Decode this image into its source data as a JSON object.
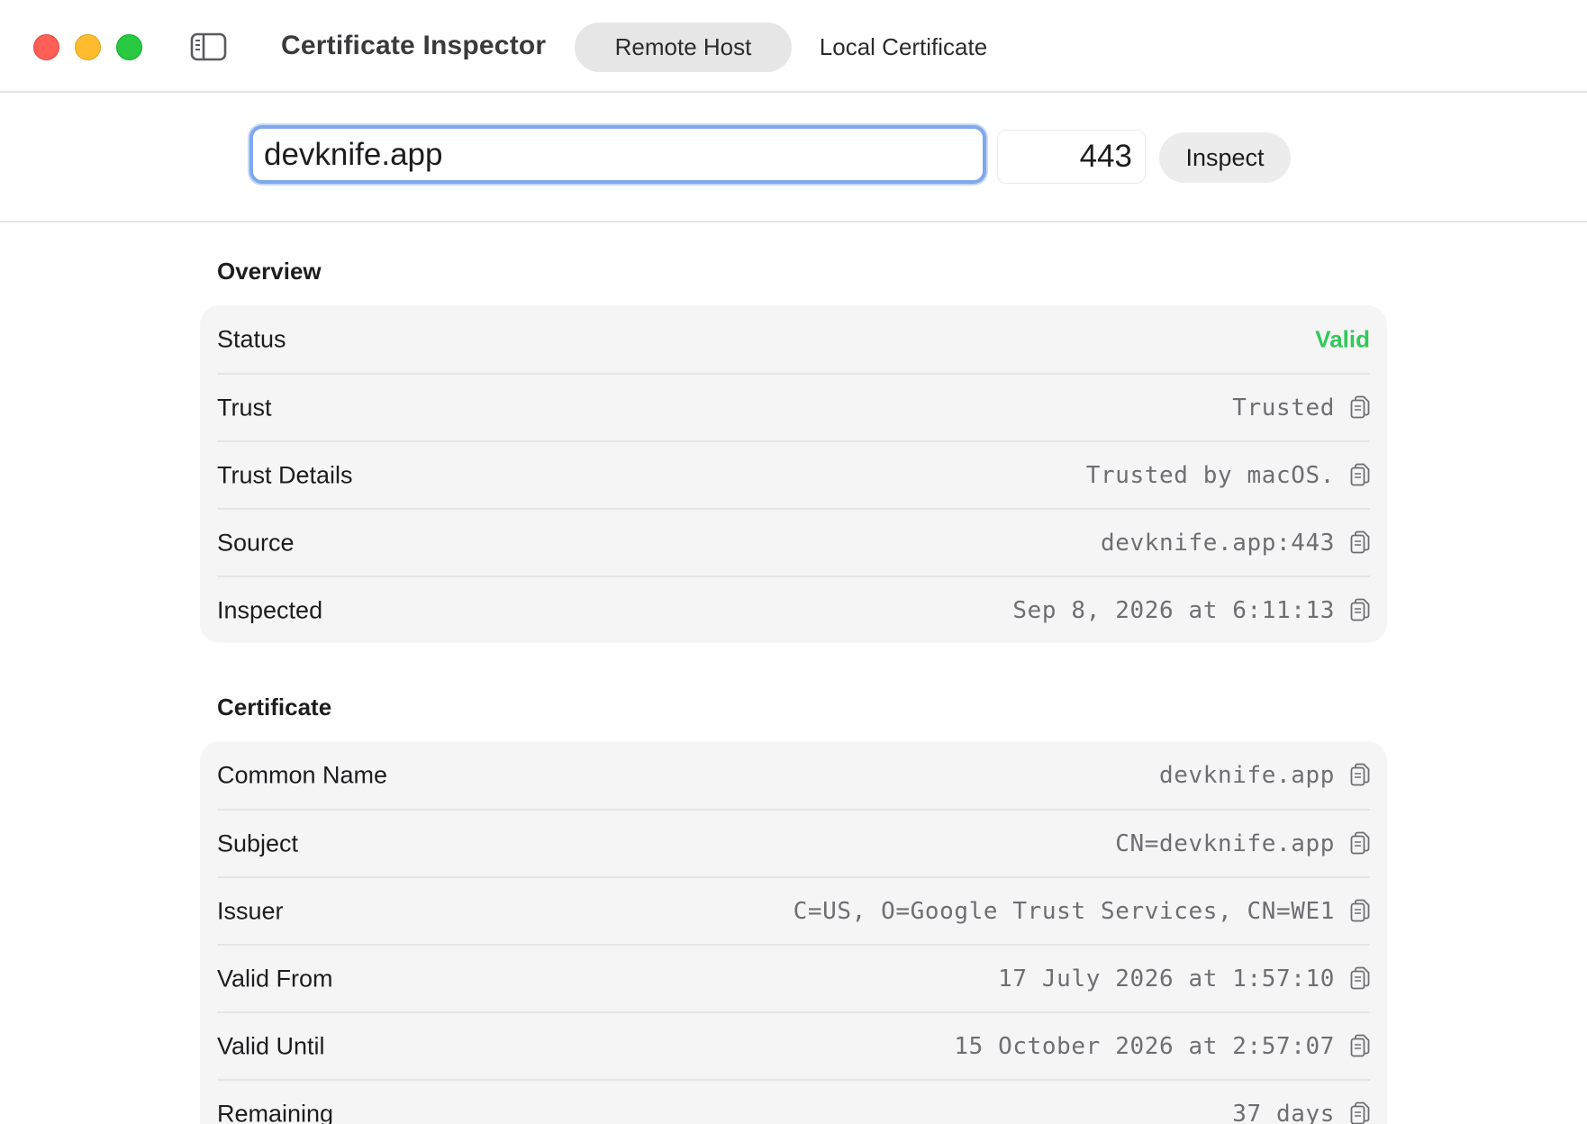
{
  "window": {
    "title": "Certificate Inspector",
    "tabs": [
      {
        "label": "Remote Host",
        "selected": true
      },
      {
        "label": "Local Certificate",
        "selected": false
      }
    ]
  },
  "query": {
    "host": "devknife.app",
    "port": "443",
    "inspect_label": "Inspect"
  },
  "overview": {
    "title": "Overview",
    "status": {
      "label": "Status",
      "value": "Valid",
      "color": "#34c759"
    },
    "rows": [
      {
        "label": "Trust",
        "value": "Trusted"
      },
      {
        "label": "Trust Details",
        "value": "Trusted by macOS."
      },
      {
        "label": "Source",
        "value": "devknife.app:443"
      },
      {
        "label": "Inspected",
        "value": "Sep 8, 2026 at 6:11:13"
      }
    ]
  },
  "certificate": {
    "title": "Certificate",
    "rows": [
      {
        "label": "Common Name",
        "value": "devknife.app"
      },
      {
        "label": "Subject",
        "value": "CN=devknife.app"
      },
      {
        "label": "Issuer",
        "value": "C=US, O=Google Trust Services, CN=WE1"
      },
      {
        "label": "Valid From",
        "value": "17 July 2026 at 1:57:10"
      },
      {
        "label": "Valid Until",
        "value": "15 October 2026 at 2:57:07"
      },
      {
        "label": "Remaining",
        "value": "37 days"
      }
    ]
  },
  "icons": {
    "copy": "copy-icon",
    "sidebar": "sidebar-toggle-icon"
  },
  "colors": {
    "accent_focus": "#7fa8ec",
    "valid": "#34c759",
    "close": "#fe5f57",
    "minimize": "#febc2e",
    "zoom": "#28c840"
  }
}
